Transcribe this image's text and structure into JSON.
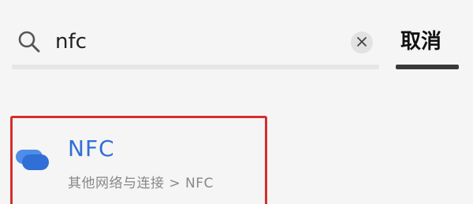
{
  "search": {
    "icon": "search-icon",
    "value": "nfc",
    "placeholder": "",
    "clear_icon": "close-icon",
    "cancel_label": "取消"
  },
  "results": [
    {
      "icon": "nfc-toggle-icon",
      "title": "NFC",
      "path": "其他网络与连接 > NFC"
    }
  ],
  "colors": {
    "accent": "#2f6fd6",
    "highlight_border": "#d62e2e",
    "icon_blue": "#2f6fd6",
    "icon_light_blue": "#4f8de8"
  }
}
